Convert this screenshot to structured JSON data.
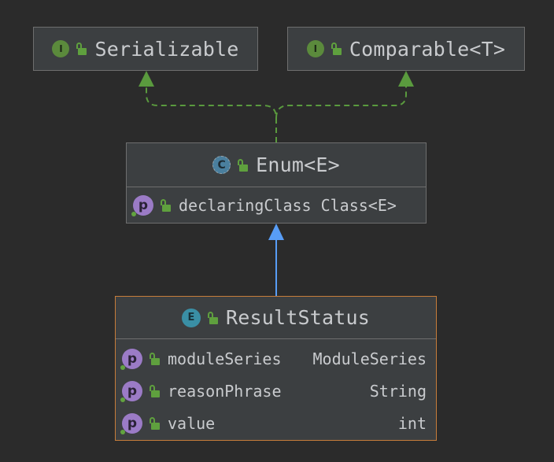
{
  "diagram": {
    "nodes": {
      "serializable": {
        "title": "Serializable",
        "kind_icon": "interface-icon",
        "kind_letter": "I",
        "visibility_icon": "public-lock-icon"
      },
      "comparable": {
        "title": "Comparable<T>",
        "kind_icon": "interface-icon",
        "kind_letter": "I",
        "visibility_icon": "public-lock-icon"
      },
      "enum": {
        "title": "Enum<E>",
        "kind_icon": "abstract-class-icon",
        "kind_letter": "C",
        "visibility_icon": "public-lock-icon",
        "members": [
          {
            "badge": "p",
            "name": "declaringClass",
            "type": "Class<E>",
            "icon": "property-icon"
          }
        ]
      },
      "resultstatus": {
        "title": "ResultStatus",
        "kind_icon": "enum-icon",
        "kind_letter": "E",
        "visibility_icon": "public-lock-icon",
        "members": [
          {
            "badge": "p",
            "name": "moduleSeries",
            "type": "ModuleSeries",
            "icon": "property-icon"
          },
          {
            "badge": "p",
            "name": "reasonPhrase",
            "type": "String",
            "icon": "property-icon"
          },
          {
            "badge": "p",
            "name": "value",
            "type": "int",
            "icon": "property-icon"
          }
        ]
      }
    },
    "edges": [
      {
        "from": "enum",
        "to": "serializable",
        "kind": "implements",
        "style": "dashed",
        "color": "#5a9a3e"
      },
      {
        "from": "enum",
        "to": "comparable",
        "kind": "implements",
        "style": "dashed",
        "color": "#5a9a3e"
      },
      {
        "from": "resultstatus",
        "to": "enum",
        "kind": "extends",
        "style": "solid",
        "color": "#589df6"
      }
    ],
    "colors": {
      "background": "#2b2b2b",
      "node_fill": "#3c3f41",
      "node_border": "#6e6e6e",
      "selected_border": "#c77d3a",
      "text": "#c9cbce"
    }
  }
}
